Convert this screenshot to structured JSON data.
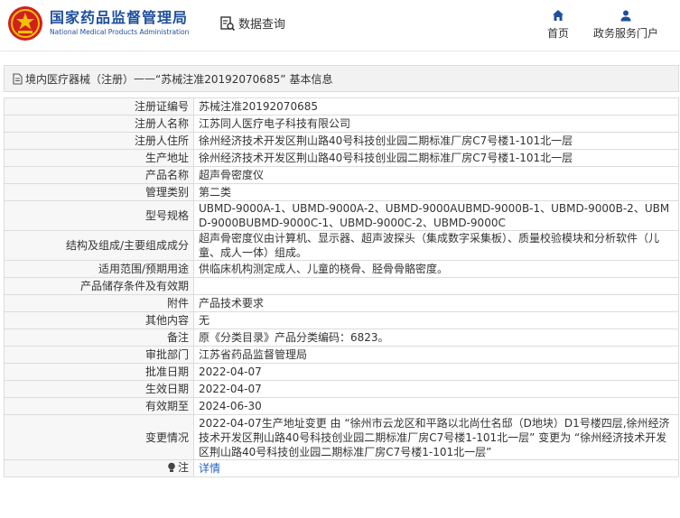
{
  "header": {
    "logo_cn": "国家药品监督管理局",
    "logo_en": "National Medical Products Administration",
    "search_label": "数据查询",
    "nav": {
      "home": "首页",
      "service": "政务服务门户"
    }
  },
  "title": {
    "prefix": "境内医疗器械（注册）",
    "separator": "——",
    "main": "“苏械注准20192070685”",
    "suffix": "基本信息"
  },
  "rows": [
    {
      "label": "注册证编号",
      "value": "苏械注准20192070685"
    },
    {
      "label": "注册人名称",
      "value": "江苏同人医疗电子科技有限公司"
    },
    {
      "label": "注册人住所",
      "value": "徐州经济技术开发区荆山路40号科技创业园二期标准厂房C7号楼1-101北一层"
    },
    {
      "label": "生产地址",
      "value": "徐州经济技术开发区荆山路40号科技创业园二期标准厂房C7号楼1-101北一层"
    },
    {
      "label": "产品名称",
      "value": "超声骨密度仪"
    },
    {
      "label": "管理类别",
      "value": "第二类"
    },
    {
      "label": "型号规格",
      "value": "UBMD-9000A-1、UBMD-9000A-2、UBMD-9000AUBMD-9000B-1、UBMD-9000B-2、UBMD-9000BUBMD-9000C-1、UBMD-9000C-2、UBMD-9000C"
    },
    {
      "label": "结构及组成/主要组成成分",
      "value": "超声骨密度仪由计算机、显示器、超声波探头（集成数字采集板）、质量校验模块和分析软件（儿童、成人一体）组成。"
    },
    {
      "label": "适用范围/预期用途",
      "value": "供临床机构测定成人、儿童的桡骨、胫骨骨骼密度。"
    },
    {
      "label": "产品储存条件及有效期",
      "value": ""
    },
    {
      "label": "附件",
      "value": "产品技术要求"
    },
    {
      "label": "其他内容",
      "value": "无"
    },
    {
      "label": "备注",
      "value": "原《分类目录》产品分类编码：6823。"
    },
    {
      "label": "审批部门",
      "value": "江苏省药品监督管理局"
    },
    {
      "label": "批准日期",
      "value": "2022-04-07"
    },
    {
      "label": "生效日期",
      "value": "2022-04-07"
    },
    {
      "label": "有效期至",
      "value": "2024-06-30"
    },
    {
      "label": "变更情况",
      "value": "2022-04-07生产地址变更 由 “徐州市云龙区和平路以北尚仕名邸（D地块）D1号楼四层,徐州经济技术开发区荆山路40号科技创业园二期标准厂房C7号楼1-101北一层” 变更为 “徐州经济技术开发区荆山路40号科技创业园二期标准厂房C7号楼1-101北一层”"
    }
  ],
  "note": {
    "label": "注",
    "link": "详情"
  },
  "colors": {
    "brand_blue": "#1e4f9c",
    "emblem_red": "#d21f1f",
    "emblem_gold": "#f2c200",
    "link_blue": "#1e64c8"
  },
  "icons": {
    "search": "magnifier-doc-icon",
    "home": "home-icon",
    "service": "user-icon",
    "title": "document-icon",
    "note": "lightbulb-icon"
  }
}
